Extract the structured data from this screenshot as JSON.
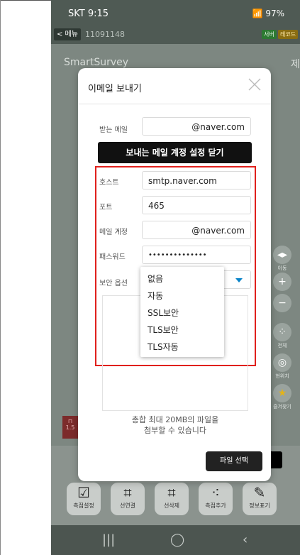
{
  "status": {
    "time": "SKT 9:15",
    "carrier_icon": "k-icon",
    "right": "97%"
  },
  "appbar": {
    "menu_label": "< 메뉴",
    "doc_id": "11091148",
    "tag_server": "서버",
    "tag_record": "레코드"
  },
  "map": {
    "title": "SmartSurvey",
    "edge_text": "제"
  },
  "side_controls": [
    {
      "name": "layer-toggle",
      "glyph": "◂▸",
      "label": "이동"
    },
    {
      "name": "zoom-in",
      "glyph": "+",
      "label": ""
    },
    {
      "name": "zoom-out",
      "glyph": "−",
      "label": ""
    },
    {
      "name": "all-view",
      "glyph": "⁘",
      "label": "전체"
    },
    {
      "name": "my-location",
      "glyph": "◎",
      "label": "현위치"
    },
    {
      "name": "favorites",
      "glyph": "★",
      "label": "즐겨찾기"
    }
  ],
  "scale_label": "1.5",
  "toolbar": [
    {
      "glyph": "☑",
      "label": "측점설정"
    },
    {
      "glyph": "⌗",
      "label": "선연결"
    },
    {
      "glyph": "⌗",
      "label": "선삭제"
    },
    {
      "glyph": "⁖",
      "label": "측점추가"
    },
    {
      "glyph": "✎",
      "label": "정보표기"
    }
  ],
  "dialog": {
    "title": "이메일 보내기",
    "recipient_label": "받는 메일",
    "recipient_value": "@naver.com",
    "toggle_button": "보내는 메일 계정 설정 닫기",
    "host_label": "호스트",
    "host_value": "smtp.naver.com",
    "port_label": "포트",
    "port_value": "465",
    "account_label": "메일 계정",
    "account_value": "@naver.com",
    "password_label": "패스워드",
    "password_value": "••••••••••••••",
    "security_label": "보안 옵션",
    "security_options": [
      "없음",
      "자동",
      "SSL보안",
      "TLS보안",
      "TLS자동"
    ],
    "attach_text_1": "총합 최대 20MB의 파일을",
    "attach_text_2": "첨부할 수 있습니다",
    "file_button": "파일 선택"
  },
  "colors": {
    "highlight": "#e0201c",
    "accent": "#0a84c9"
  }
}
